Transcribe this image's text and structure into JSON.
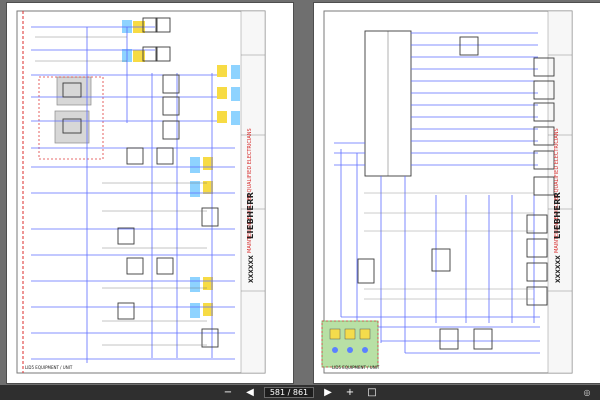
{
  "viewer": {
    "page_indicator": "581 / 861",
    "nav": {
      "zoom_out_icon": "zoom-out-icon",
      "prev_icon": "previous-page-icon",
      "next_icon": "next-page-icon",
      "zoom_in_icon": "zoom-in-icon",
      "fit_icon": "fit-page-icon"
    }
  },
  "pages": [
    {
      "title": "LIEBHERR",
      "subtitle": "LID5 EQUIPMENT / UNIT",
      "drawing_no": "XXXXXX",
      "warning": "MAINTENANCE ONLY BY QUALIFIED ELECTRICIANS"
    },
    {
      "title": "LIEBHERR",
      "subtitle": "LID5 EQUIPMENT / UNIT",
      "drawing_no": "XXXXXX",
      "warning": "MAINTENANCE ONLY BY QUALIFIED ELECTRICIANS"
    }
  ]
}
